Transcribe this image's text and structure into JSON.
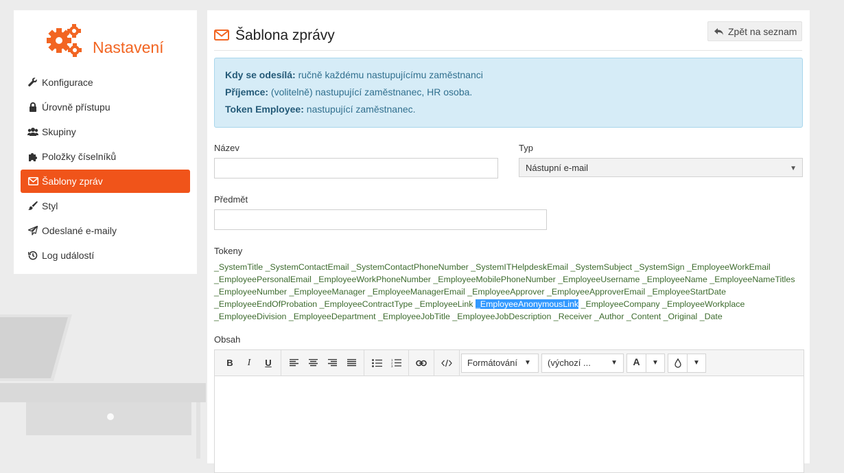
{
  "sidebar": {
    "brand": "Nastavení",
    "items": [
      {
        "label": "Konfigurace",
        "icon": "wrench-icon"
      },
      {
        "label": "Úrovně přístupu",
        "icon": "lock-icon"
      },
      {
        "label": "Skupiny",
        "icon": "users-icon"
      },
      {
        "label": "Položky číselníků",
        "icon": "puzzle-icon"
      },
      {
        "label": "Šablony zpráv",
        "icon": "envelope-icon",
        "active": true
      },
      {
        "label": "Styl",
        "icon": "brush-icon"
      },
      {
        "label": "Odeslané e-maily",
        "icon": "paper-plane-icon"
      },
      {
        "label": "Log událostí",
        "icon": "history-icon"
      }
    ]
  },
  "header": {
    "title": "Šablona zprávy",
    "back_label": "Zpět na seznam"
  },
  "info": {
    "send_label": "Kdy se odesílá:",
    "send_value": " ručně každému nastupujícímu zaměstnanci",
    "recipient_label": "Příjemce:",
    "recipient_value": " (volitelně) nastupující zaměstnanec, HR osoba.",
    "token_label": "Token Employee:",
    "token_value": " nastupující zaměstnanec."
  },
  "form": {
    "name_label": "Název",
    "name_value": "",
    "type_label": "Typ",
    "type_value": "Nástupní e-mail",
    "subject_label": "Předmět",
    "subject_value": "",
    "tokens_label": "Tokeny",
    "content_label": "Obsah"
  },
  "tokens": [
    "_SystemTitle",
    "_SystemContactEmail",
    "_SystemContactPhoneNumber",
    "_SystemITHelpdeskEmail",
    "_SystemSubject",
    "_SystemSign",
    "_EmployeeWorkEmail",
    "_EmployeePersonalEmail",
    "_EmployeeWorkPhoneNumber",
    "_EmployeeMobilePhoneNumber",
    "_EmployeeUsername",
    "_EmployeeName",
    "_EmployeeNameTitles",
    "_EmployeeNumber",
    "_EmployeeManager",
    "_EmployeeManagerEmail",
    "_EmployeeApprover",
    "_EmployeeApproverEmail",
    "_EmployeeStartDate",
    "_EmployeeEndOfProbation",
    "_EmployeeContractType",
    "_EmployeeLink",
    "_EmployeeAnonymousLink",
    "_EmployeeCompany",
    "_EmployeeWorkplace",
    "_EmployeeDivision",
    "_EmployeeDepartment",
    "_EmployeeJobTitle",
    "_EmployeeJobDescription",
    "_Receiver",
    "_Author",
    "_Content",
    "_Original",
    "_Date"
  ],
  "selected_token": "_EmployeeAnonymousLink",
  "editor": {
    "format_label": "Formátování",
    "font_label": "(výchozí ...",
    "text_color_glyph": "A"
  },
  "colors": {
    "accent": "#f0541a",
    "brand": "#f26522",
    "info_bg": "#d6ecf7",
    "token_text": "#3d6b2e",
    "selection": "#3399ff"
  }
}
